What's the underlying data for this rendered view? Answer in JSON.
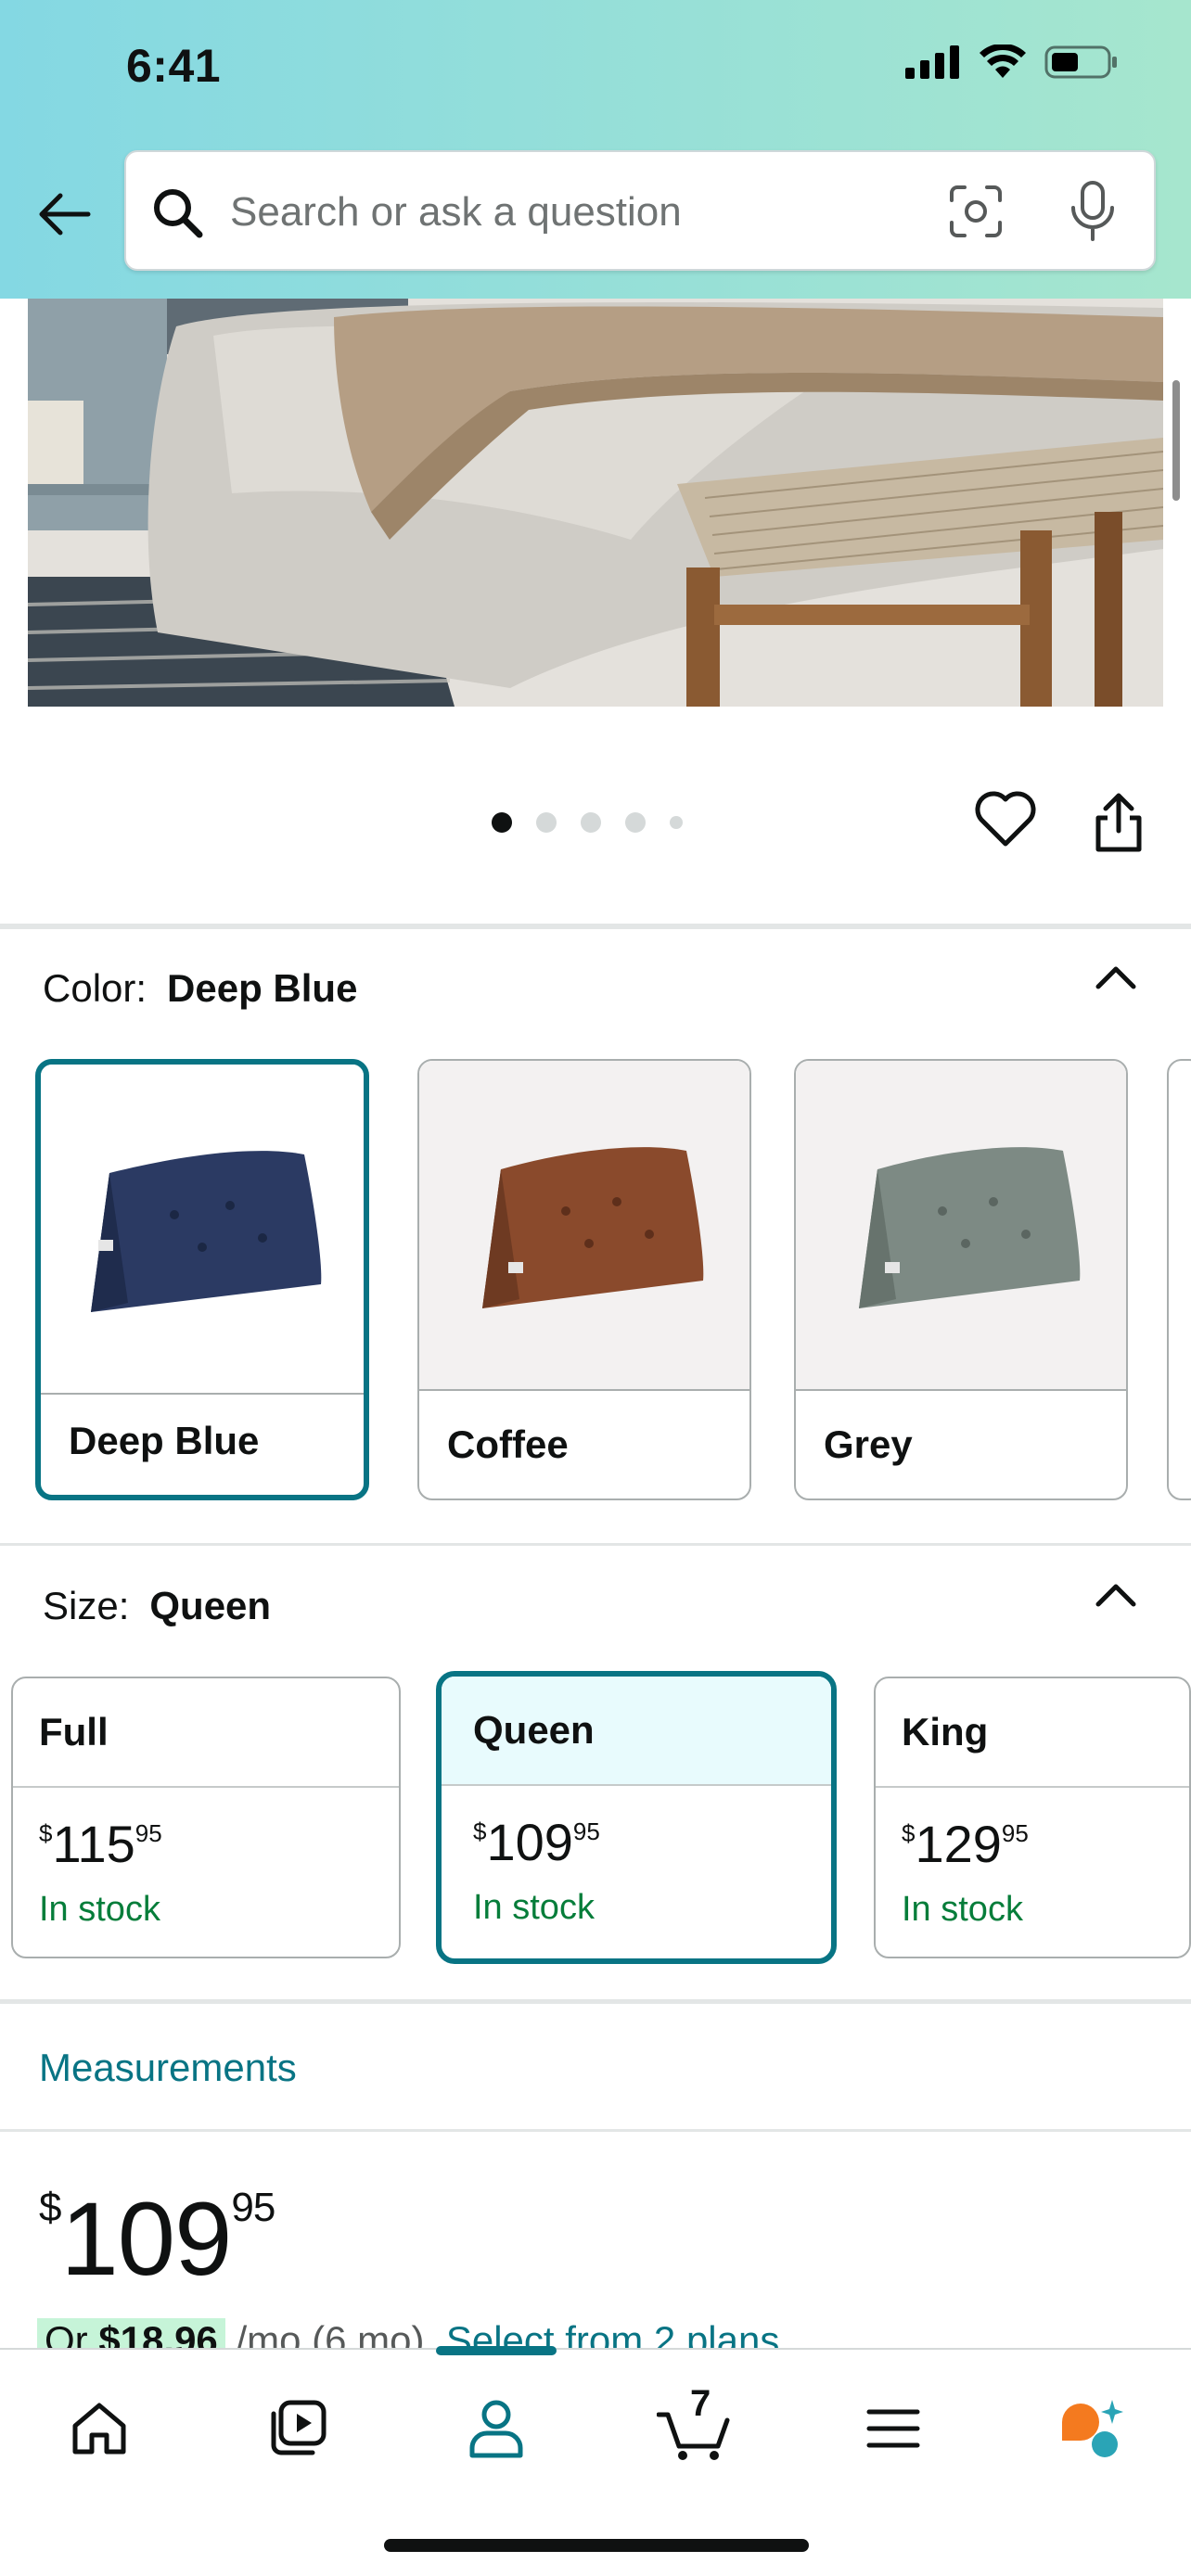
{
  "status_bar": {
    "time": "6:41"
  },
  "search": {
    "placeholder": "Search or ask a question"
  },
  "gallery": {
    "image_count": 5,
    "active_index": 0
  },
  "color": {
    "label": "Color:",
    "selected": "Deep Blue",
    "options": [
      {
        "name": "Deep Blue",
        "swatch": "#2b3a63",
        "selected": true
      },
      {
        "name": "Coffee",
        "swatch": "#8a4a2c",
        "selected": false
      },
      {
        "name": "Grey",
        "swatch": "#7d8a84",
        "selected": false
      }
    ]
  },
  "size": {
    "label": "Size:",
    "selected": "Queen",
    "options": [
      {
        "name": "Full",
        "currency": "$",
        "whole": "115",
        "fraction": "95",
        "stock": "In stock",
        "selected": false
      },
      {
        "name": "Queen",
        "currency": "$",
        "whole": "109",
        "fraction": "95",
        "stock": "In stock",
        "selected": true
      },
      {
        "name": "King",
        "currency": "$",
        "whole": "129",
        "fraction": "95",
        "stock": "In stock",
        "selected": false
      }
    ]
  },
  "measurements_link": "Measurements",
  "price": {
    "currency": "$",
    "whole": "109",
    "fraction": "95"
  },
  "monthly": {
    "prefix": "Or",
    "amount": "$18.96",
    "term": "/mo (6 mo).",
    "link": "Select from 2 plans"
  },
  "bottom_nav": {
    "items": [
      "home-icon",
      "video-icon",
      "account-icon",
      "cart-icon",
      "menu-icon",
      "rufus-icon"
    ],
    "active": "account-icon",
    "cart_count": "7"
  },
  "colors": {
    "accent": "#087484",
    "in_stock": "#067d3a",
    "highlight": "#c6f4d8"
  }
}
